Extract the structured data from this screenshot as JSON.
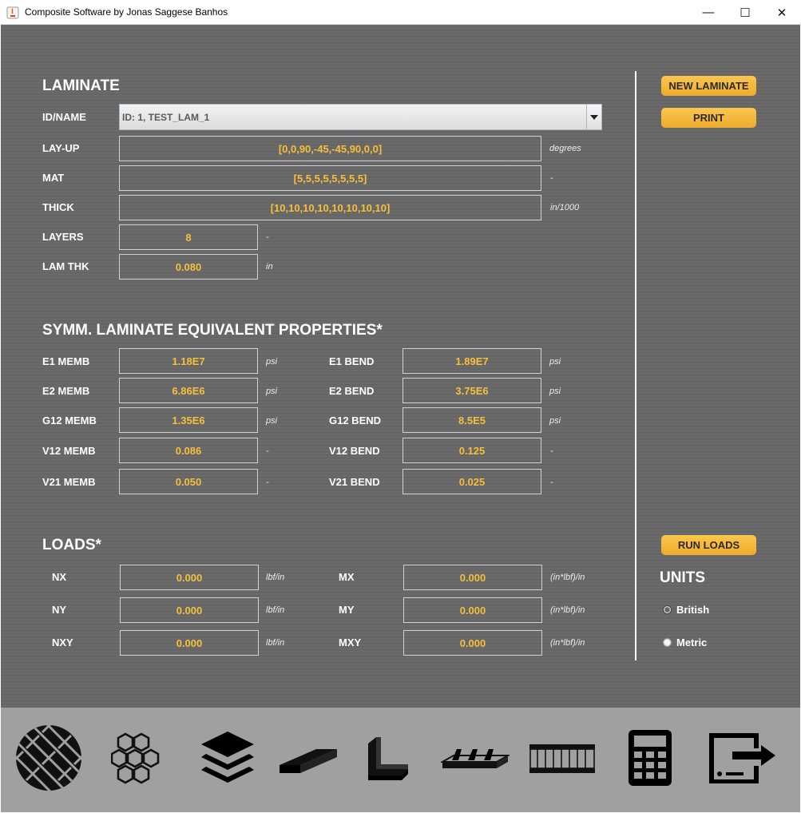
{
  "window": {
    "title": "Composite Software by Jonas Saggese Banhos",
    "minimize": "—",
    "maximize": "☐",
    "close": "✕"
  },
  "laminate": {
    "title": "LAMINATE",
    "id_label": "ID/NAME",
    "id_value": "ID: 1, TEST_LAM_1",
    "layup_label": "LAY-UP",
    "layup_value": "[0,0,90,-45,-45,90,0,0]",
    "layup_unit": "degrees",
    "mat_label": "MAT",
    "mat_value": "[5,5,5,5,5,5,5,5]",
    "mat_unit": "-",
    "thick_label": "THICK",
    "thick_value": "[10,10,10,10,10,10,10,10]",
    "thick_unit": "in/1000",
    "layers_label": "LAYERS",
    "layers_value": "8",
    "layers_unit": "-",
    "lamthk_label": "LAM THK",
    "lamthk_value": "0.080",
    "lamthk_unit": "in"
  },
  "buttons": {
    "new_laminate": "NEW LAMINATE",
    "print": "PRINT",
    "run_loads": "RUN LOADS"
  },
  "properties": {
    "title": "SYMM. LAMINATE EQUIVALENT PROPERTIES*",
    "membrane": [
      {
        "label": "E1 MEMB",
        "value": "1.18E7",
        "unit": "psi"
      },
      {
        "label": "E2 MEMB",
        "value": "6.86E6",
        "unit": "psi"
      },
      {
        "label": "G12 MEMB",
        "value": "1.35E6",
        "unit": "psi"
      },
      {
        "label": "V12 MEMB",
        "value": "0.086",
        "unit": "-"
      },
      {
        "label": "V21 MEMB",
        "value": "0.050",
        "unit": "-"
      }
    ],
    "bending": [
      {
        "label": "E1 BEND",
        "value": "1.89E7",
        "unit": "psi"
      },
      {
        "label": "E2 BEND",
        "value": "3.75E6",
        "unit": "psi"
      },
      {
        "label": "G12 BEND",
        "value": "8.5E5",
        "unit": "psi"
      },
      {
        "label": "V12 BEND",
        "value": "0.125",
        "unit": "-"
      },
      {
        "label": "V21 BEND",
        "value": "0.025",
        "unit": "-"
      }
    ]
  },
  "loads": {
    "title": "LOADS*",
    "forces": [
      {
        "label": "NX",
        "value": "0.000",
        "unit": "lbf/in"
      },
      {
        "label": "NY",
        "value": "0.000",
        "unit": "lbf/in"
      },
      {
        "label": "NXY",
        "value": "0.000",
        "unit": "lbf/in"
      }
    ],
    "moments": [
      {
        "label": "MX",
        "value": "0.000",
        "unit": "(in*lbf)/in"
      },
      {
        "label": "MY",
        "value": "0.000",
        "unit": "(in*lbf)/in"
      },
      {
        "label": "MXY",
        "value": "0.000",
        "unit": "(in*lbf)/in"
      }
    ]
  },
  "units": {
    "title": "UNITS",
    "british": "British",
    "metric": "Metric",
    "selected": "British"
  },
  "toolbar": {
    "icons": [
      "woven-fabric-icon",
      "honeycomb-icon",
      "layers-icon",
      "plate-icon",
      "angle-profile-icon",
      "stiffened-panel-icon",
      "sandwich-panel-icon",
      "calculator-icon",
      "exit-icon"
    ]
  },
  "colors": {
    "background": "#676767",
    "value_text": "#f7bf3a",
    "button": "#f5b73c",
    "toolbar": "#a0a0a0"
  }
}
